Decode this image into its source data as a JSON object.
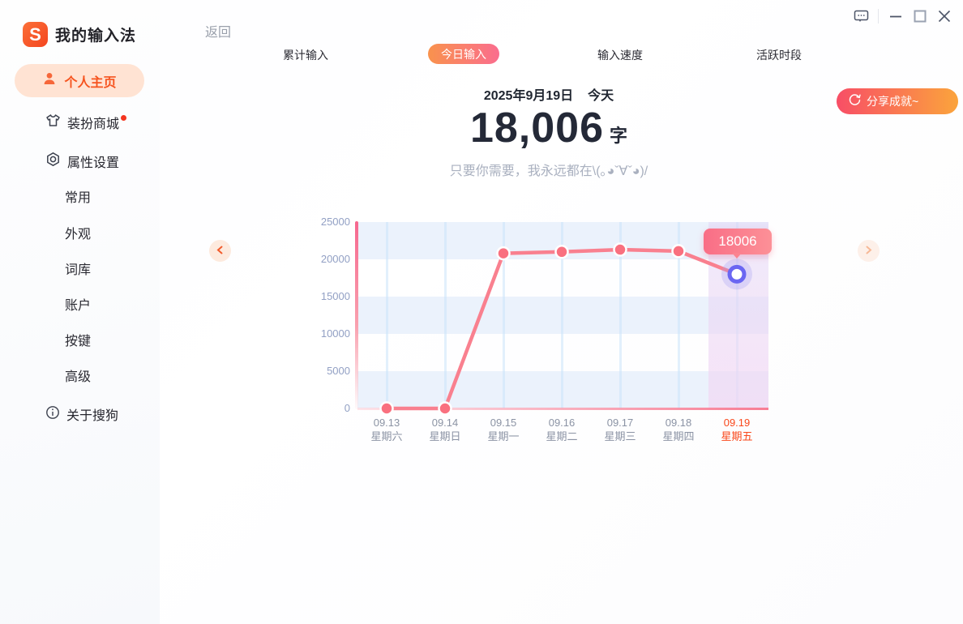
{
  "app": {
    "title": "我的输入法",
    "logo_letter": "S"
  },
  "sidebar": {
    "active_item": {
      "label": "个人主页"
    },
    "items": [
      {
        "label": "装扮商城",
        "has_badge": true
      },
      {
        "label": "属性设置",
        "has_badge": false
      }
    ],
    "sub_items": [
      {
        "label": "常用"
      },
      {
        "label": "外观"
      },
      {
        "label": "词库"
      },
      {
        "label": "账户"
      },
      {
        "label": "按键"
      },
      {
        "label": "高级"
      }
    ],
    "about": {
      "label": "关于搜狗"
    }
  },
  "topbar": {
    "back_label": "返回"
  },
  "tabs": [
    {
      "label": "累计输入",
      "active": false
    },
    {
      "label": "今日输入",
      "active": true
    },
    {
      "label": "输入速度",
      "active": false
    },
    {
      "label": "活跃时段",
      "active": false
    }
  ],
  "summary": {
    "date": "2025年9月19日",
    "date_tag": "今天",
    "count": "18,006",
    "unit": "字",
    "subtitle": "只要你需要，我永远都在\\(｡◕ˇ∀ˇ◕)/"
  },
  "share_button": {
    "label": "分享成就~"
  },
  "chart_data": {
    "type": "line",
    "x": [
      "09.13",
      "09.14",
      "09.15",
      "09.16",
      "09.17",
      "09.18",
      "09.19"
    ],
    "weekday_labels": [
      "星期六",
      "星期日",
      "星期一",
      "星期二",
      "星期三",
      "星期四",
      "星期五"
    ],
    "values": [
      0,
      0,
      20800,
      21000,
      21300,
      21100,
      18006
    ],
    "ylim": [
      0,
      25000
    ],
    "yticks": [
      0,
      5000,
      10000,
      15000,
      20000,
      25000
    ],
    "grid": true,
    "legend": "none",
    "tooltip": {
      "index": 6,
      "value": "18006"
    },
    "highlight_index": 6,
    "selected_x": "09.19"
  },
  "colors": {
    "accent_orange": "#f6541f",
    "line_pink": "#f9808f",
    "dot_pink": "#f9707f",
    "marker_ring": "#6a66f2",
    "band_blue": "#ebf2fc",
    "active_pill_bg": "#ffe3d3",
    "tab_gradient": "#f9924d→#fa6d8e",
    "share_gradient": "#f84e66→#fba43c"
  }
}
